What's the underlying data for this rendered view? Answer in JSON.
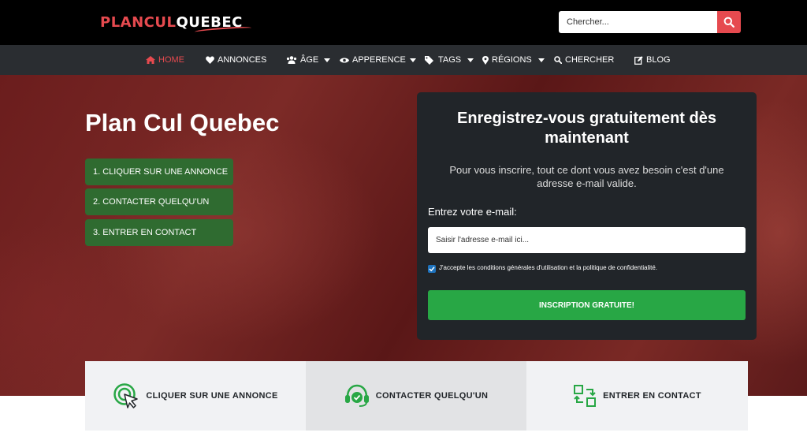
{
  "logo": {
    "part1": "PLANCUL",
    "part2": "QUEBEC"
  },
  "search": {
    "placeholder": "Chercher..."
  },
  "nav": {
    "home": "HOME",
    "annonces": "ANNONCES",
    "age": "ÂGE",
    "apperence": "APPERENCE",
    "tags": "TAGS",
    "regions": "RÉGIONS",
    "chercher": "CHERCHER",
    "blog": "BLOG"
  },
  "hero": {
    "title": "Plan Cul Quebec",
    "steps": [
      "1. CLIQUER SUR UNE ANNONCE",
      "2. CONTACTER QUELQU'UN",
      "3. ENTRER EN CONTACT"
    ]
  },
  "register": {
    "title": "Enregistrez-vous gratuitement dès maintenant",
    "text": "Pour vous inscrire, tout ce dont vous avez besoin c'est d'une adresse e-mail valide.",
    "email_label": "Entrez votre e-mail:",
    "email_placeholder": "Saisir l'adresse e-mail ici...",
    "terms": "J'accepte les conditions générales d'utilisation et la politique de confidentialité.",
    "terms_checked": true,
    "submit": "INSCRIPTION GRATUITE!"
  },
  "features": [
    {
      "label": "CLIQUER SUR UNE ANNONCE",
      "icon": "cursor-click-icon"
    },
    {
      "label": "CONTACTER QUELQU'UN",
      "icon": "headset-icon"
    },
    {
      "label": "ENTRER EN CONTACT",
      "icon": "exchange-icon"
    }
  ],
  "colors": {
    "accent": "#e64a4f",
    "green": "#28a745",
    "step_green": "#2f6b30",
    "dark": "#212529"
  }
}
